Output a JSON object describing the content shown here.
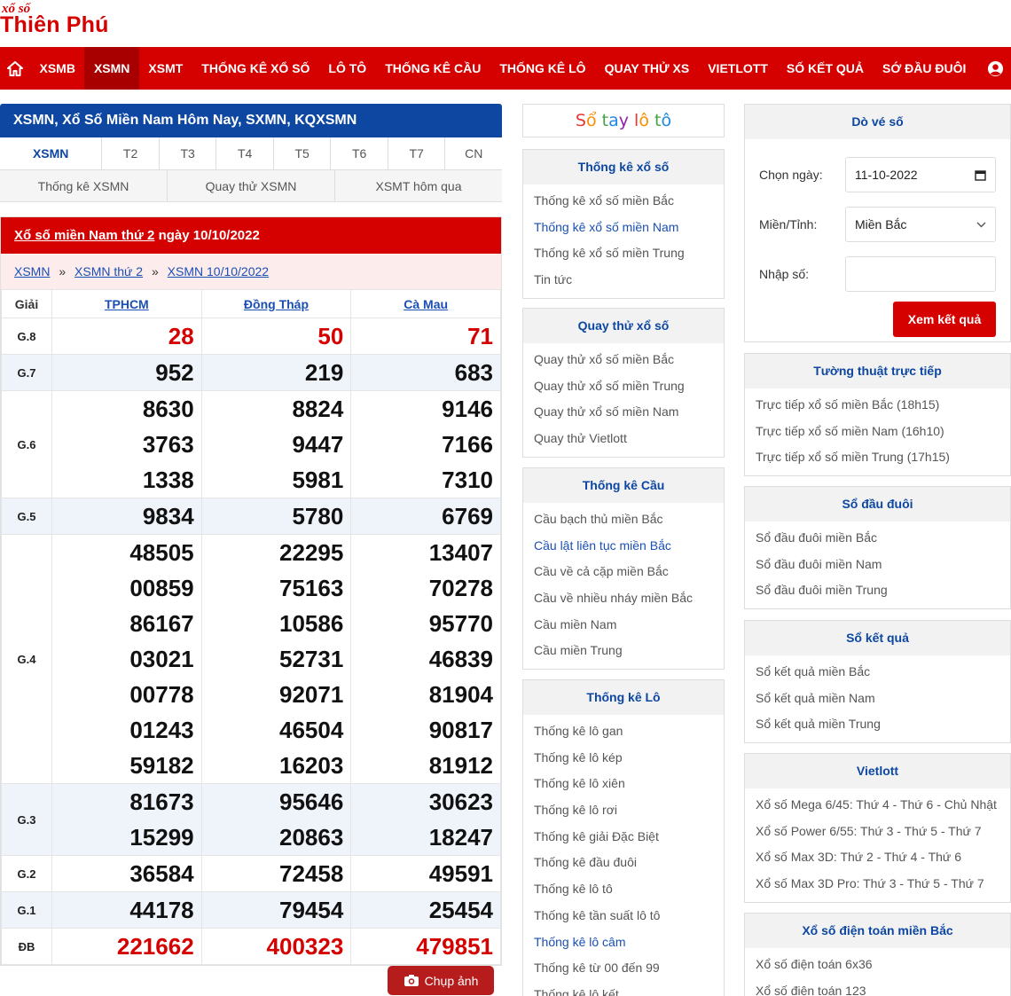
{
  "logo": {
    "small": "xổ số",
    "big": "Thiên Phú"
  },
  "nav": [
    "XSMB",
    "XSMN",
    "XSMT",
    "THỐNG KÊ XỔ SỐ",
    "LÔ TÔ",
    "THỐNG KÊ CẦU",
    "THỐNG KÊ LÔ",
    "QUAY THỬ XS",
    "VIETLOTT",
    "SỐ KẾT QUẢ",
    "SỚ ĐẦU ĐUÔI"
  ],
  "page_title": "XSMN, Xổ Số Miền Nam Hôm Nay, SXMN, KQXSMN",
  "days": [
    "XSMN",
    "T2",
    "T3",
    "T4",
    "T5",
    "T6",
    "T7",
    "CN"
  ],
  "subtabs": [
    "Thống kê XSMN",
    "Quay thử XSMN",
    "XSMT hôm qua"
  ],
  "result": {
    "head_link": "Xổ số miền Nam thứ 2",
    "head_date": "ngày 10/10/2022",
    "crumb": [
      "XSMN",
      "XSMN thứ 2",
      "XSMN 10/10/2022"
    ],
    "crumb_sep": "»",
    "col_prize": "Giải",
    "provinces": [
      "TPHCM",
      "Đồng Tháp",
      "Cà Mau"
    ],
    "prizes": [
      {
        "name": "G.8",
        "red": true,
        "vals": [
          [
            "28"
          ],
          [
            "50"
          ],
          [
            "71"
          ]
        ]
      },
      {
        "name": "G.7",
        "vals": [
          [
            "952"
          ],
          [
            "219"
          ],
          [
            "683"
          ]
        ]
      },
      {
        "name": "G.6",
        "vals": [
          [
            "8630",
            "3763",
            "1338"
          ],
          [
            "8824",
            "9447",
            "5981"
          ],
          [
            "9146",
            "7166",
            "7310"
          ]
        ]
      },
      {
        "name": "G.5",
        "vals": [
          [
            "9834"
          ],
          [
            "5780"
          ],
          [
            "6769"
          ]
        ]
      },
      {
        "name": "G.4",
        "vals": [
          [
            "48505",
            "00859",
            "86167",
            "03021",
            "00778",
            "01243",
            "59182"
          ],
          [
            "22295",
            "75163",
            "10586",
            "52731",
            "92071",
            "46504",
            "16203"
          ],
          [
            "13407",
            "70278",
            "95770",
            "46839",
            "81904",
            "90817",
            "81912"
          ]
        ]
      },
      {
        "name": "G.3",
        "vals": [
          [
            "81673",
            "15299"
          ],
          [
            "95646",
            "20863"
          ],
          [
            "30623",
            "18247"
          ]
        ]
      },
      {
        "name": "G.2",
        "vals": [
          [
            "36584"
          ],
          [
            "72458"
          ],
          [
            "49591"
          ]
        ]
      },
      {
        "name": "G.1",
        "vals": [
          [
            "44178"
          ],
          [
            "79454"
          ],
          [
            "25454"
          ]
        ]
      },
      {
        "name": "ĐB",
        "red": true,
        "vals": [
          [
            "221662"
          ],
          [
            "400323"
          ],
          [
            "479851"
          ]
        ]
      }
    ],
    "snapshot_label": "Chụp ảnh"
  },
  "banner": "Sổ tay lô tô",
  "mid_boxes": [
    {
      "title": "Thống kê xổ số",
      "items": [
        "Thống kê xổ số miền Bắc",
        "Thống kê xổ số miền Nam",
        "Thống kê xổ số miền Trung",
        "Tin tức"
      ],
      "blue": [
        1
      ]
    },
    {
      "title": "Quay thử xổ số",
      "items": [
        "Quay thử xổ số miền Bắc",
        "Quay thử xổ số miền Trung",
        "Quay thử xổ số miền Nam",
        "Quay thử Vietlott"
      ],
      "blue": []
    },
    {
      "title": "Thống kê Cầu",
      "items": [
        "Cầu bạch thủ miền Bắc",
        "Cầu lật liên tục miền Bắc",
        "Cầu về cả cặp miền Bắc",
        "Cầu về nhiều nháy miền Bắc",
        "Cầu miền Nam",
        "Cầu miền Trung"
      ],
      "blue": [
        1
      ]
    },
    {
      "title": "Thống kê Lô",
      "items": [
        "Thống kê lô gan",
        "Thống kê lô kép",
        "Thống kê lô xiên",
        "Thống kê lô rơi",
        "Thống kê giải Đặc Biệt",
        "Thống kê đầu đuôi",
        "Thống kê lô tô",
        "Thống kê tần suất lô tô",
        "Thống kê lô câm",
        "Thống kê từ 00 đến 99",
        "Thống kê lô kết"
      ],
      "blue": [
        8
      ]
    }
  ],
  "search": {
    "title": "Dò vé số",
    "date_label": "Chọn ngày:",
    "date_value": "11-10-2022",
    "region_label": "Miền/Tỉnh:",
    "region_value": "Miền Bắc",
    "number_label": "Nhập số:",
    "submit": "Xem kết quả"
  },
  "right_boxes": [
    {
      "title": "Tường thuật trực tiếp",
      "items": [
        "Trực tiếp xổ số miền Bắc (18h15)",
        "Trực tiếp xổ số miền Nam (16h10)",
        "Trực tiếp xổ số miền Trung (17h15)"
      ]
    },
    {
      "title": "Sổ đầu đuôi",
      "items": [
        "Sổ đầu đuôi miền Bắc",
        "Sổ đầu đuôi miền Nam",
        "Sổ đầu đuôi miền Trung"
      ]
    },
    {
      "title": "Sổ kết quả",
      "items": [
        "Sổ kết quả miền Bắc",
        "Sổ kết quả miền Nam",
        "Sổ kết quả miền Trung"
      ]
    },
    {
      "title": "Vietlott",
      "items": [
        "Xổ số Mega 6/45: Thứ 4 - Thứ 6 - Chủ Nhật",
        "Xổ số Power 6/55: Thứ 3 - Thứ 5 - Thứ 7",
        "Xổ số Max 3D: Thứ 2 - Thứ 4 - Thứ 6",
        "Xổ số Max 3D Pro: Thứ 3 - Thứ 5 - Thứ 7"
      ]
    },
    {
      "title": "Xổ số điện toán miền Bắc",
      "items": [
        "Xổ số điện toán 6x36",
        "Xổ số điện toán 123"
      ]
    }
  ],
  "colors": {
    "red": "#d50000",
    "blue": "#0d47a1",
    "link": "#1a4fb4"
  }
}
